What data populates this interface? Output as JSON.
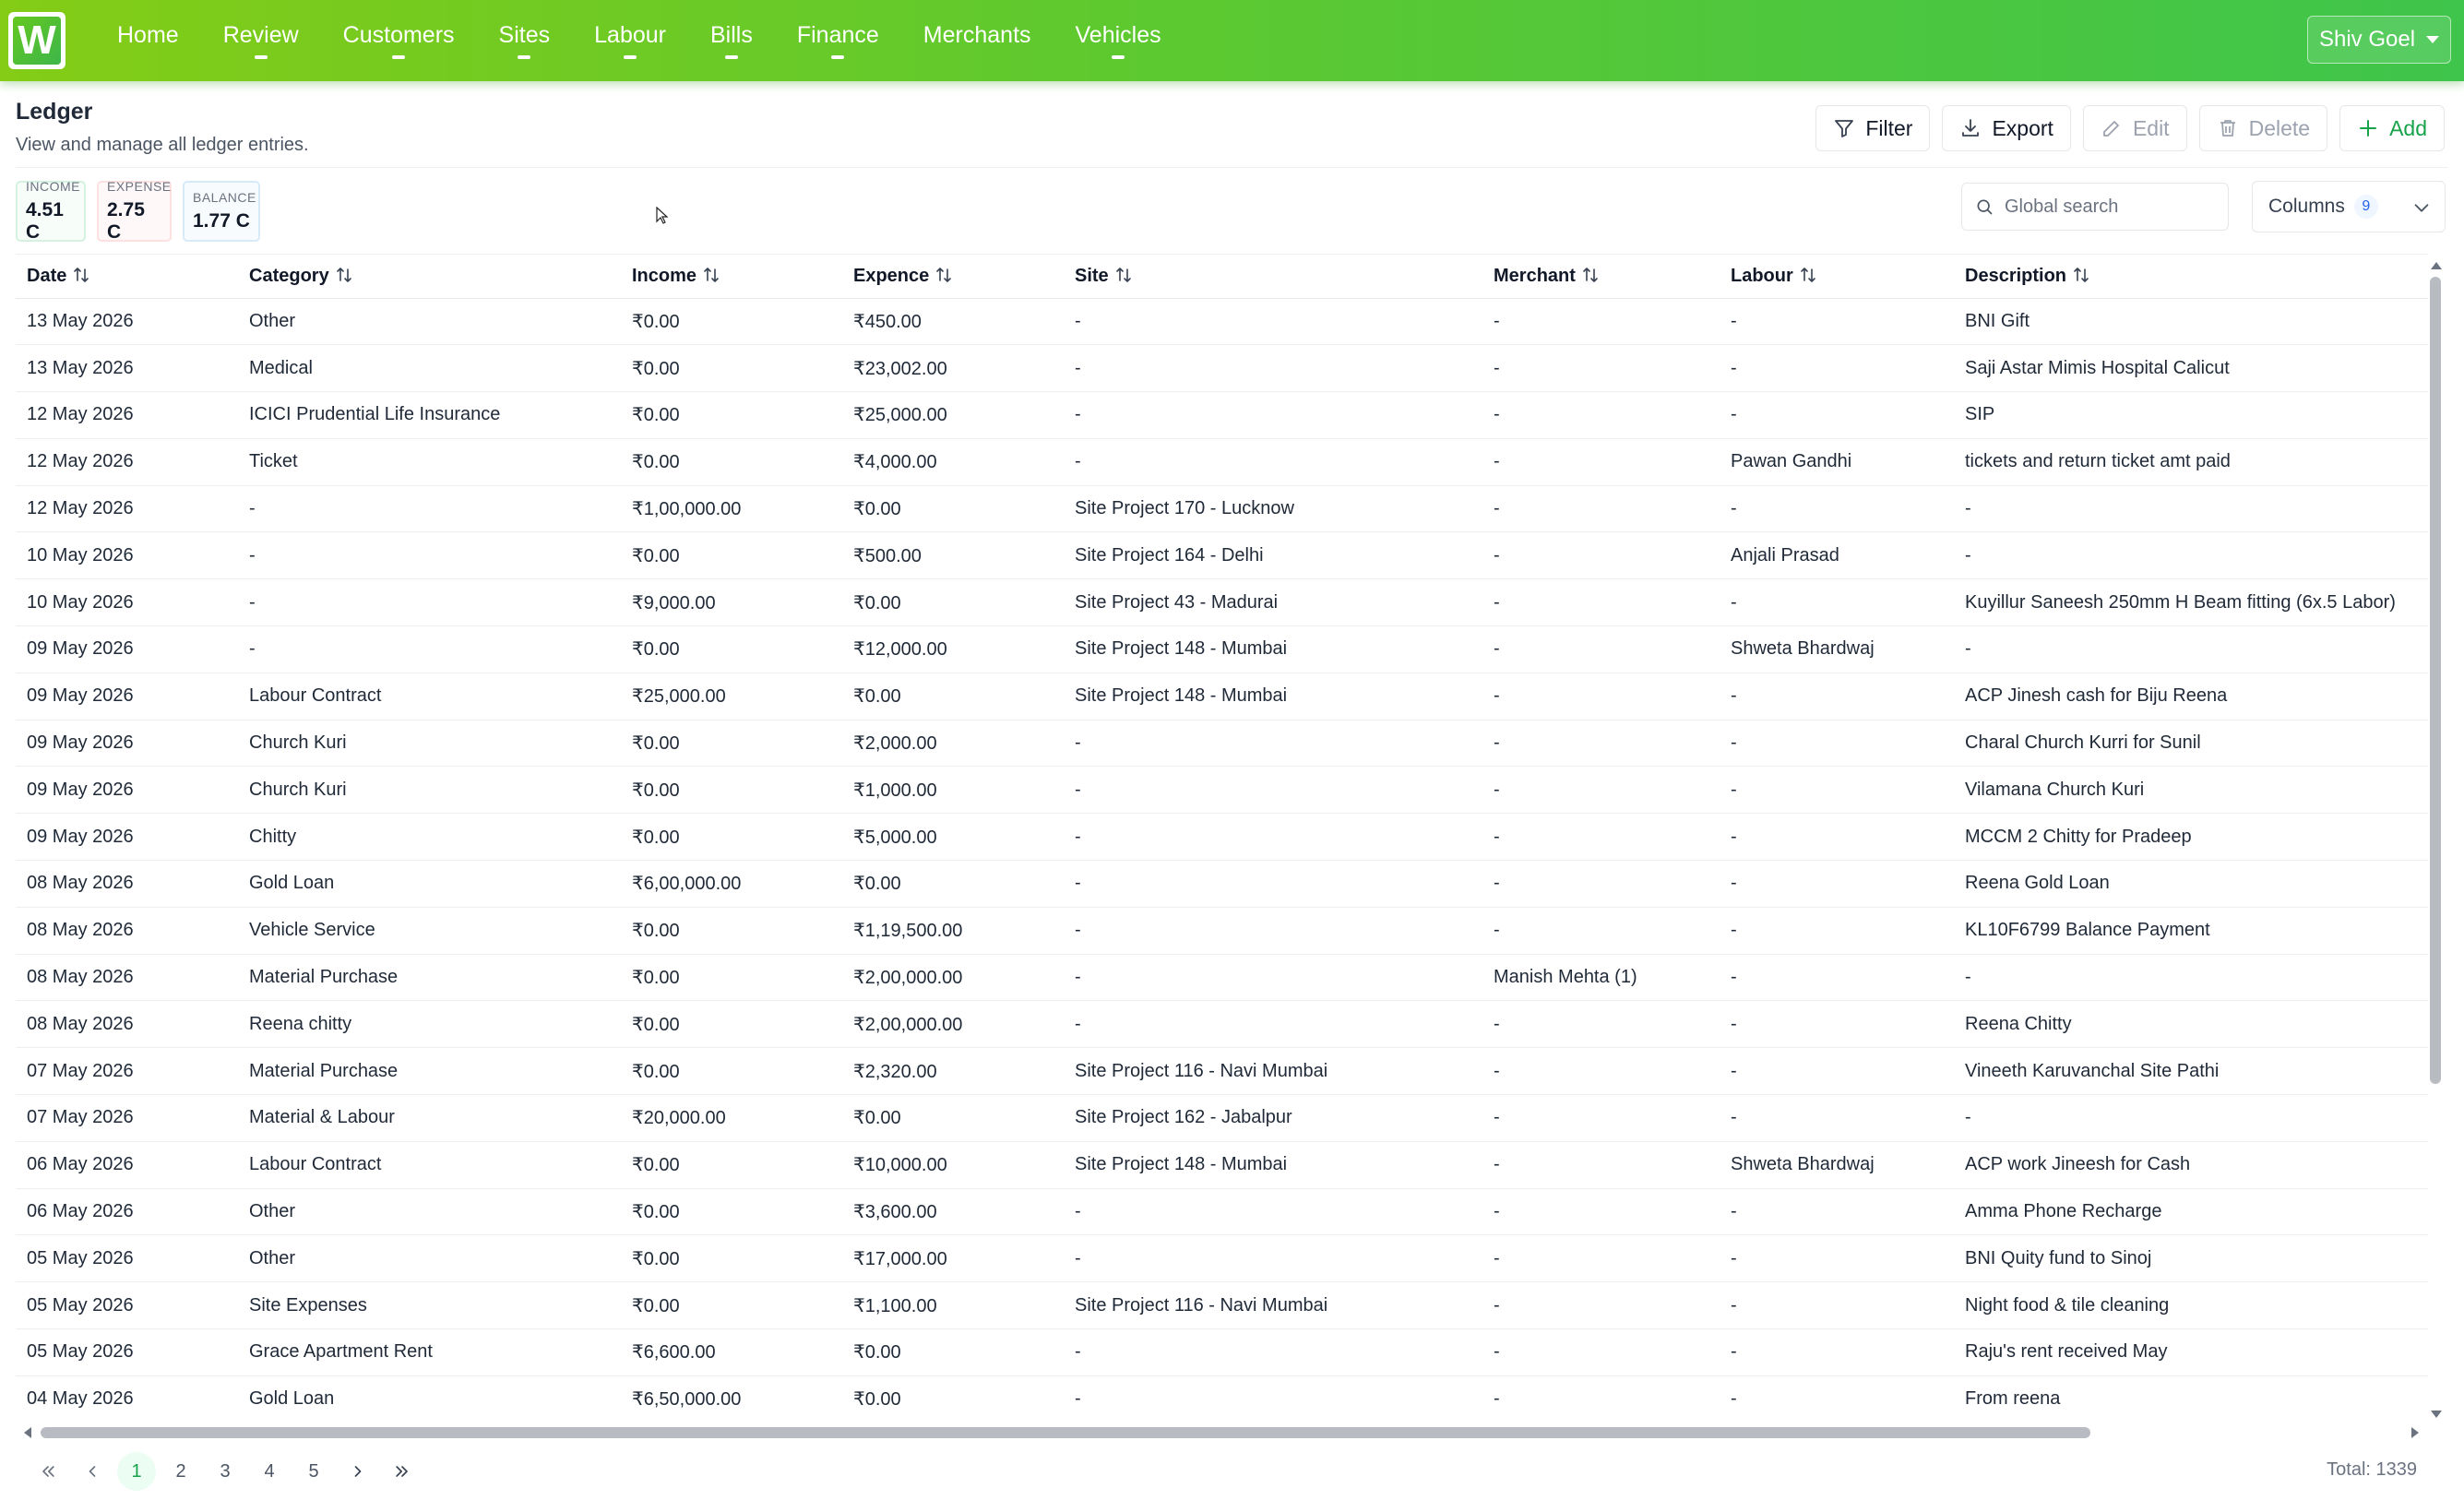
{
  "brand": {
    "logo_letter": "W",
    "colors": {
      "nav_start": "#84cc16",
      "nav_end": "#3fc54b",
      "accent": "#16a34a"
    }
  },
  "nav": {
    "items": [
      {
        "label": "Home",
        "has_dropdown": false
      },
      {
        "label": "Review",
        "has_dropdown": true
      },
      {
        "label": "Customers",
        "has_dropdown": true
      },
      {
        "label": "Sites",
        "has_dropdown": true
      },
      {
        "label": "Labour",
        "has_dropdown": true
      },
      {
        "label": "Bills",
        "has_dropdown": true
      },
      {
        "label": "Finance",
        "has_dropdown": true
      },
      {
        "label": "Merchants",
        "has_dropdown": false
      },
      {
        "label": "Vehicles",
        "has_dropdown": true
      }
    ],
    "user": "Shiv Goel"
  },
  "page": {
    "title": "Ledger",
    "subtitle": "View and manage all ledger entries."
  },
  "toolbar": {
    "filter": "Filter",
    "export": "Export",
    "edit": "Edit",
    "delete": "Delete",
    "add": "Add"
  },
  "stats": {
    "income": {
      "label": "INCOME",
      "value": "4.51 C"
    },
    "expense": {
      "label": "EXPENSE",
      "value": "2.75 C"
    },
    "balance": {
      "label": "BALANCE",
      "value": "1.77 C"
    }
  },
  "search": {
    "placeholder": "Global search",
    "value": ""
  },
  "columns_button": {
    "label": "Columns",
    "count": "9"
  },
  "table": {
    "headers": [
      "Date",
      "Category",
      "Income",
      "Expence",
      "Site",
      "Merchant",
      "Labour",
      "Description"
    ],
    "rows": [
      [
        "13 May 2026",
        "Other",
        "₹0.00",
        "₹450.00",
        "-",
        "-",
        "-",
        "BNI Gift"
      ],
      [
        "13 May 2026",
        "Medical",
        "₹0.00",
        "₹23,002.00",
        "-",
        "-",
        "-",
        "Saji Astar Mimis Hospital Calicut"
      ],
      [
        "12 May 2026",
        "ICICI Prudential Life Insurance",
        "₹0.00",
        "₹25,000.00",
        "-",
        "-",
        "-",
        "SIP"
      ],
      [
        "12 May 2026",
        "Ticket",
        "₹0.00",
        "₹4,000.00",
        "-",
        "-",
        "Pawan Gandhi",
        "tickets and return ticket amt paid"
      ],
      [
        "12 May 2026",
        "-",
        "₹1,00,000.00",
        "₹0.00",
        "Site Project 170 - Lucknow",
        "-",
        "-",
        "-"
      ],
      [
        "10 May 2026",
        "-",
        "₹0.00",
        "₹500.00",
        "Site Project 164 - Delhi",
        "-",
        "Anjali Prasad",
        "-"
      ],
      [
        "10 May 2026",
        "-",
        "₹9,000.00",
        "₹0.00",
        "Site Project 43 - Madurai",
        "-",
        "-",
        "Kuyillur Saneesh 250mm H Beam fitting (6x.5 Labor)"
      ],
      [
        "09 May 2026",
        "-",
        "₹0.00",
        "₹12,000.00",
        "Site Project 148 - Mumbai",
        "-",
        "Shweta Bhardwaj",
        "-"
      ],
      [
        "09 May 2026",
        "Labour Contract",
        "₹25,000.00",
        "₹0.00",
        "Site Project 148 - Mumbai",
        "-",
        "-",
        "ACP Jinesh cash for Biju Reena"
      ],
      [
        "09 May 2026",
        "Church Kuri",
        "₹0.00",
        "₹2,000.00",
        "-",
        "-",
        "-",
        "Charal Church Kurri for Sunil"
      ],
      [
        "09 May 2026",
        "Church Kuri",
        "₹0.00",
        "₹1,000.00",
        "-",
        "-",
        "-",
        "Vilamana Church Kuri"
      ],
      [
        "09 May 2026",
        "Chitty",
        "₹0.00",
        "₹5,000.00",
        "-",
        "-",
        "-",
        "MCCM 2 Chitty for Pradeep"
      ],
      [
        "08 May 2026",
        "Gold Loan",
        "₹6,00,000.00",
        "₹0.00",
        "-",
        "-",
        "-",
        "Reena Gold Loan"
      ],
      [
        "08 May 2026",
        "Vehicle Service",
        "₹0.00",
        "₹1,19,500.00",
        "-",
        "-",
        "-",
        "KL10F6799 Balance Payment"
      ],
      [
        "08 May 2026",
        "Material Purchase",
        "₹0.00",
        "₹2,00,000.00",
        "-",
        "Manish Mehta (1)",
        "-",
        "-"
      ],
      [
        "08 May 2026",
        "Reena chitty",
        "₹0.00",
        "₹2,00,000.00",
        "-",
        "-",
        "-",
        "Reena Chitty"
      ],
      [
        "07 May 2026",
        "Material Purchase",
        "₹0.00",
        "₹2,320.00",
        "Site Project 116 - Navi Mumbai",
        "-",
        "-",
        "Vineeth Karuvanchal Site Pathi"
      ],
      [
        "07 May 2026",
        "Material & Labour",
        "₹20,000.00",
        "₹0.00",
        "Site Project 162 - Jabalpur",
        "-",
        "-",
        "-"
      ],
      [
        "06 May 2026",
        "Labour Contract",
        "₹0.00",
        "₹10,000.00",
        "Site Project 148 - Mumbai",
        "-",
        "Shweta Bhardwaj",
        "ACP work Jineesh for Cash"
      ],
      [
        "06 May 2026",
        "Other",
        "₹0.00",
        "₹3,600.00",
        "-",
        "-",
        "-",
        "Amma Phone Recharge"
      ],
      [
        "05 May 2026",
        "Other",
        "₹0.00",
        "₹17,000.00",
        "-",
        "-",
        "-",
        "BNI Quity fund to Sinoj"
      ],
      [
        "05 May 2026",
        "Site Expenses",
        "₹0.00",
        "₹1,100.00",
        "Site Project 116 - Navi Mumbai",
        "-",
        "-",
        "Night food & tile cleaning"
      ],
      [
        "05 May 2026",
        "Grace Apartment Rent",
        "₹6,600.00",
        "₹0.00",
        "-",
        "-",
        "-",
        "Raju's rent received May"
      ],
      [
        "04 May 2026",
        "Gold Loan",
        "₹6,50,000.00",
        "₹0.00",
        "-",
        "-",
        "-",
        "From reena"
      ]
    ]
  },
  "pagination": {
    "pages": [
      "1",
      "2",
      "3",
      "4",
      "5"
    ],
    "current": "1",
    "total": "Total: 1339"
  },
  "icons": [
    "filter-icon",
    "download-icon",
    "pencil-icon",
    "trash-icon",
    "plus-icon",
    "search-icon",
    "chevron-down-icon",
    "sort-icon"
  ]
}
